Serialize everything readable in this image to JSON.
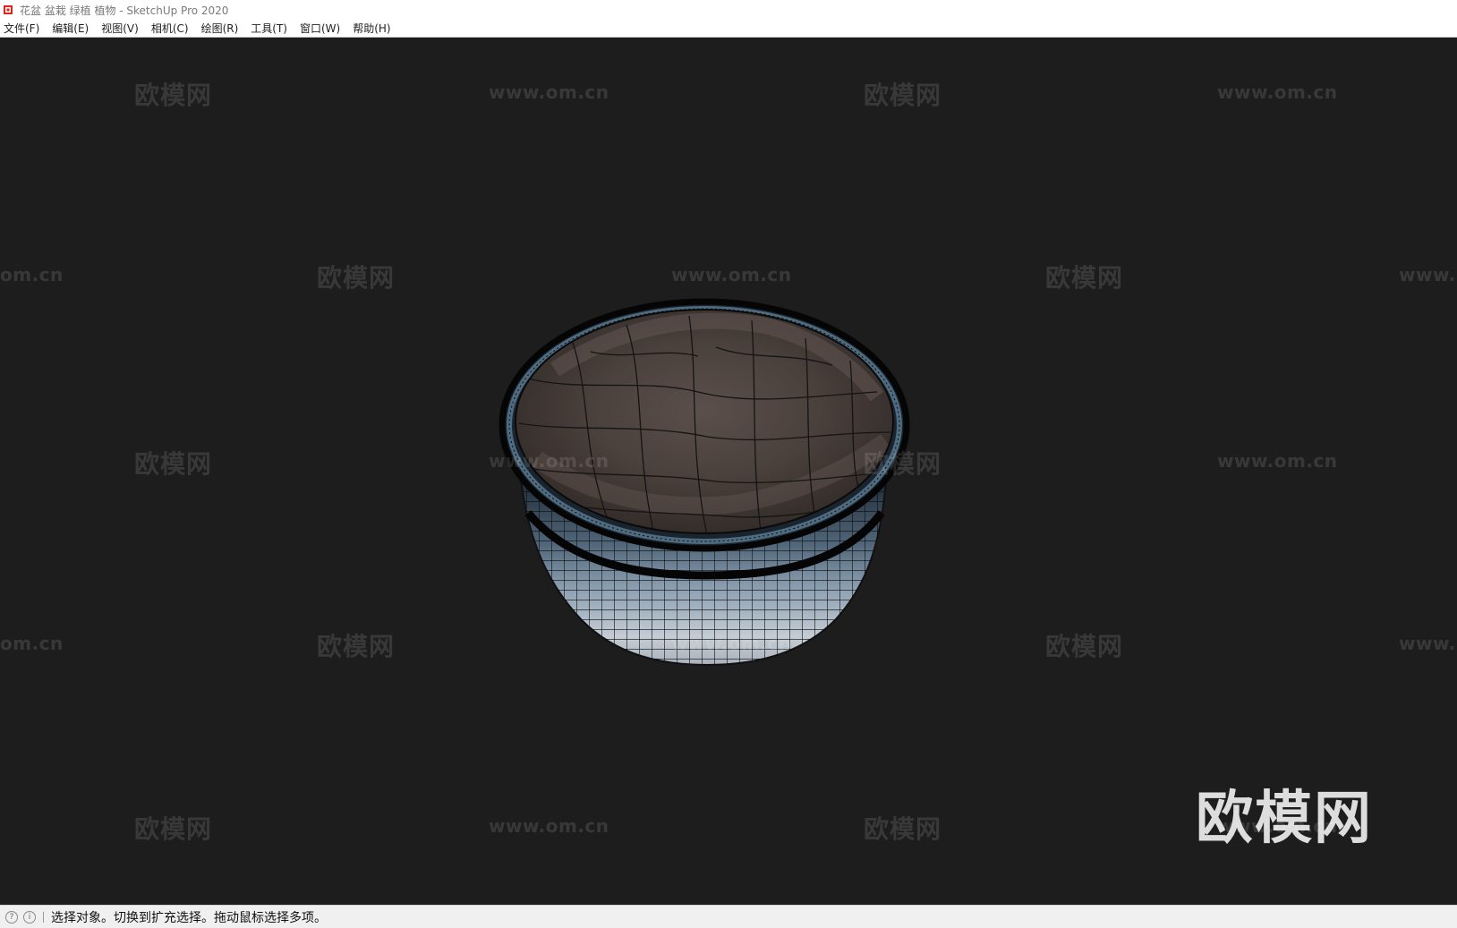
{
  "window": {
    "title": "花盆 盆栽 绿植 植物 - SketchUp Pro 2020"
  },
  "menu": {
    "items": [
      {
        "label": "文件(F)"
      },
      {
        "label": "编辑(E)"
      },
      {
        "label": "视图(V)"
      },
      {
        "label": "相机(C)"
      },
      {
        "label": "绘图(R)"
      },
      {
        "label": "工具(T)"
      },
      {
        "label": "窗口(W)"
      },
      {
        "label": "帮助(H)"
      }
    ]
  },
  "watermarks": {
    "brand": "欧模网",
    "url": "www.om.cn",
    "url_cut_left": "om.cn",
    "url_cut_right": "www."
  },
  "status": {
    "message": "选择对象。切换到扩充选择。拖动鼠标选择多项。"
  },
  "colors": {
    "viewport_bg": "#1d1d1d",
    "soil": "#4a403c",
    "pot_rim": "#0a0a0a",
    "pot_body": "#7d8ea0"
  }
}
